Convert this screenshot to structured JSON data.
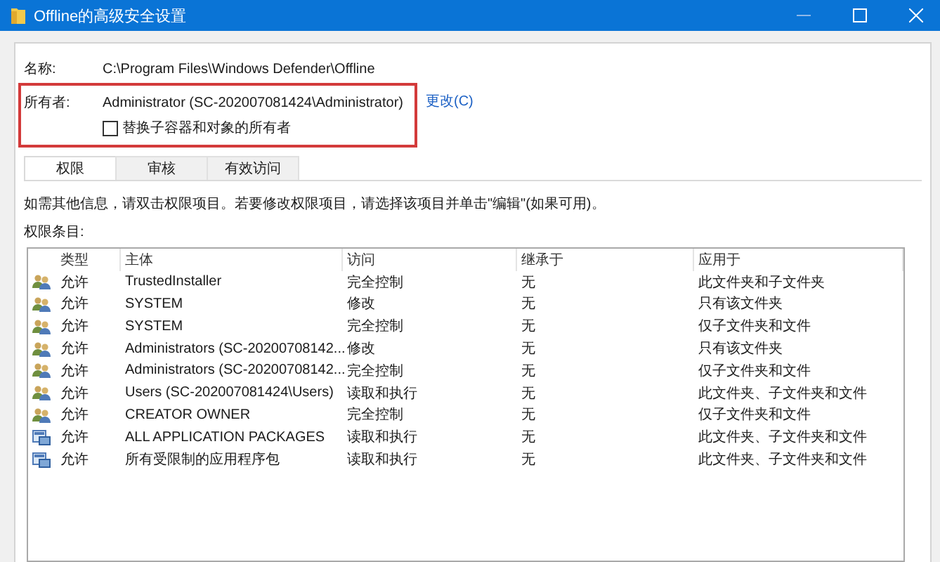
{
  "window": {
    "title": "Offline的高级安全设置"
  },
  "name": {
    "label": "名称:",
    "value": "C:\\Program Files\\Windows Defender\\Offline"
  },
  "owner": {
    "label": "所有者:",
    "value": "Administrator (SC-202007081424\\Administrator)",
    "change_link": "更改(C)"
  },
  "replace_owner": {
    "label": "替换子容器和对象的所有者",
    "checked": false
  },
  "tabs": [
    {
      "label": "权限",
      "selected": true
    },
    {
      "label": "审核",
      "selected": false
    },
    {
      "label": "有效访问",
      "selected": false
    }
  ],
  "info": "如需其他信息，请双击权限项目。若要修改权限项目，请选择该项目并单击\"编辑\"(如果可用)。",
  "entries_label": "权限条目:",
  "table": {
    "columns": [
      "类型",
      "主体",
      "访问",
      "继承于",
      "应用于"
    ],
    "rows": [
      {
        "kind": "user",
        "cells": [
          "允许",
          "TrustedInstaller",
          "完全控制",
          "无",
          "此文件夹和子文件夹"
        ]
      },
      {
        "kind": "user",
        "cells": [
          "允许",
          "SYSTEM",
          "修改",
          "无",
          "只有该文件夹"
        ]
      },
      {
        "kind": "user",
        "cells": [
          "允许",
          "SYSTEM",
          "完全控制",
          "无",
          "仅子文件夹和文件"
        ]
      },
      {
        "kind": "user",
        "cells": [
          "允许",
          "Administrators (SC-20200708142...",
          "修改",
          "无",
          "只有该文件夹"
        ]
      },
      {
        "kind": "user",
        "cells": [
          "允许",
          "Administrators (SC-20200708142...",
          "完全控制",
          "无",
          "仅子文件夹和文件"
        ]
      },
      {
        "kind": "user",
        "cells": [
          "允许",
          "Users (SC-202007081424\\Users)",
          "读取和执行",
          "无",
          "此文件夹、子文件夹和文件"
        ]
      },
      {
        "kind": "user",
        "cells": [
          "允许",
          "CREATOR OWNER",
          "完全控制",
          "无",
          "仅子文件夹和文件"
        ]
      },
      {
        "kind": "package",
        "cells": [
          "允许",
          "ALL APPLICATION PACKAGES",
          "读取和执行",
          "无",
          "此文件夹、子文件夹和文件"
        ]
      },
      {
        "kind": "package",
        "cells": [
          "允许",
          "所有受限制的应用程序包",
          "读取和执行",
          "无",
          "此文件夹、子文件夹和文件"
        ]
      }
    ]
  }
}
